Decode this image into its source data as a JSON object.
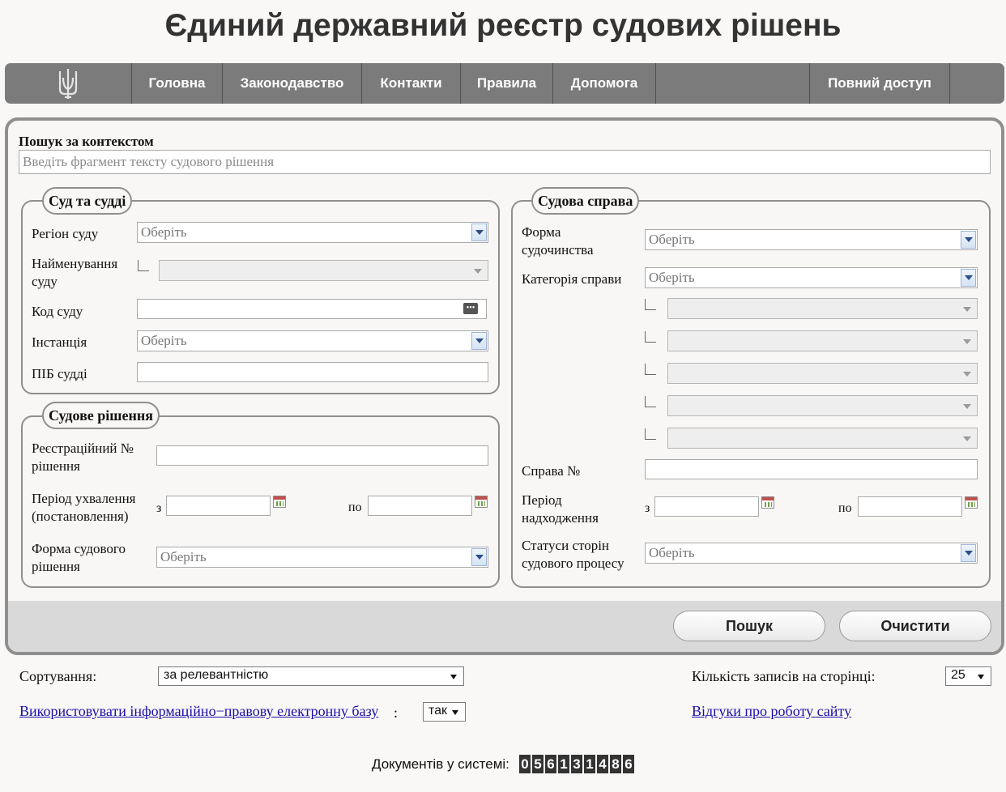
{
  "header": {
    "title": "Єдиний державний реєстр судових рішень"
  },
  "nav": {
    "items": [
      "Головна",
      "Законодавство",
      "Контакти",
      "Правила",
      "Допомога"
    ],
    "full_access": "Повний доступ"
  },
  "search": {
    "context_label": "Пошук за контекстом",
    "context_placeholder": "Введіть фрагмент тексту судового рішення"
  },
  "court_section": {
    "legend": "Суд та судді",
    "region_label": "Регіон суду",
    "region_value": "Оберіть",
    "court_name_label": "Найменування суду",
    "court_code_label": "Код суду",
    "instance_label": "Інстанція",
    "instance_value": "Оберіть",
    "judge_label": "ПІБ судді"
  },
  "decision_section": {
    "legend": "Судове рішення",
    "reg_no_label": "Реєстраційний № рішення",
    "period_label": "Період ухвалення (постановлення)",
    "from_label": "з",
    "to_label": "по",
    "form_label": "Форма судового рішення",
    "form_value": "Оберіть"
  },
  "case_section": {
    "legend": "Судова справа",
    "proceeding_label": "Форма судочинства",
    "proceeding_value": "Оберіть",
    "category_label": "Категорія справи",
    "category_value": "Оберіть",
    "case_no_label": "Справа №",
    "receipt_period_label": "Період надходження",
    "from_label": "з",
    "to_label": "по",
    "party_status_label": "Статуси сторін судового процесу",
    "party_status_value": "Оберіть"
  },
  "buttons": {
    "search": "Пошук",
    "clear": "Очистити"
  },
  "options": {
    "sort_label": "Сортування:",
    "sort_value": "за релевантністю",
    "per_page_label": "Кількість записів на сторінці:",
    "per_page_value": "25",
    "legal_base_link": "Використовувати інформаційно−правову електронну базу",
    "legal_base_colon": ":",
    "legal_base_value": "так",
    "feedback_link": "Відгуки про роботу сайту"
  },
  "footer": {
    "documents_label": "Документів у системі:",
    "documents_digits": [
      "0",
      "5",
      "6",
      "1",
      "3",
      "1",
      "4",
      "8",
      "6"
    ]
  }
}
